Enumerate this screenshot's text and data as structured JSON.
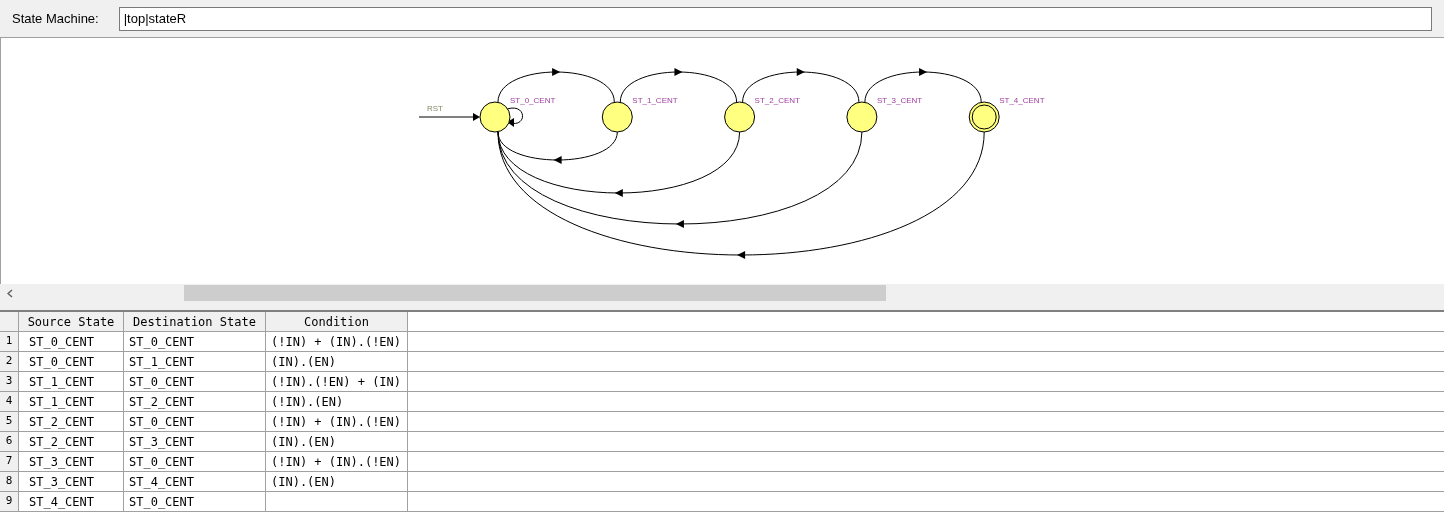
{
  "toolbar": {
    "label": "State Machine:",
    "value": "|top|stateR"
  },
  "diagram": {
    "reset_label": "RST",
    "states": [
      {
        "label": "ST_0_CENT",
        "final": false
      },
      {
        "label": "ST_1_CENT",
        "final": false
      },
      {
        "label": "ST_2_CENT",
        "final": false
      },
      {
        "label": "ST_3_CENT",
        "final": false
      },
      {
        "label": "ST_4_CENT",
        "final": true
      }
    ]
  },
  "table": {
    "columns": [
      "Source State",
      "Destination State",
      "Condition"
    ],
    "rows": [
      {
        "number": "1",
        "source": "ST_0_CENT",
        "destination": "ST_0_CENT",
        "condition": "(!IN) + (IN).(!EN)"
      },
      {
        "number": "2",
        "source": "ST_0_CENT",
        "destination": "ST_1_CENT",
        "condition": "(IN).(EN)"
      },
      {
        "number": "3",
        "source": "ST_1_CENT",
        "destination": "ST_0_CENT",
        "condition": "(!IN).(!EN) + (IN)"
      },
      {
        "number": "4",
        "source": "ST_1_CENT",
        "destination": "ST_2_CENT",
        "condition": "(!IN).(EN)"
      },
      {
        "number": "5",
        "source": "ST_2_CENT",
        "destination": "ST_0_CENT",
        "condition": "(!IN) + (IN).(!EN)"
      },
      {
        "number": "6",
        "source": "ST_2_CENT",
        "destination": "ST_3_CENT",
        "condition": "(IN).(EN)"
      },
      {
        "number": "7",
        "source": "ST_3_CENT",
        "destination": "ST_0_CENT",
        "condition": "(!IN) + (IN).(!EN)"
      },
      {
        "number": "8",
        "source": "ST_3_CENT",
        "destination": "ST_4_CENT",
        "condition": "(IN).(EN)"
      },
      {
        "number": "9",
        "source": "ST_4_CENT",
        "destination": "ST_0_CENT"
      }
    ]
  }
}
